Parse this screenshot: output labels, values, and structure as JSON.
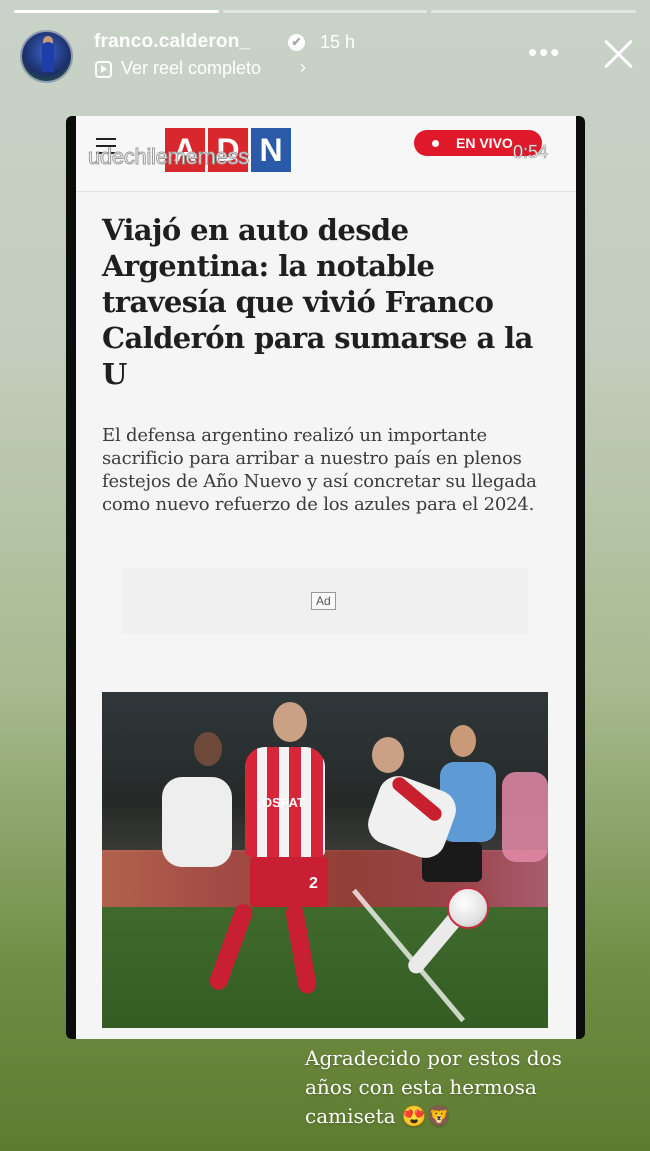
{
  "story": {
    "progress_segments": [
      {
        "state": "done"
      },
      {
        "state": "pending"
      },
      {
        "state": "pending"
      }
    ]
  },
  "header": {
    "username": "franco.calderon_",
    "verified_icon": "verified-badge-icon",
    "time_ago": "15 h",
    "reel_link": "Ver reel completo",
    "reel_chevron": "›",
    "more_icon": "more-options-icon",
    "close_icon": "close-icon"
  },
  "article": {
    "site_logo": [
      "A",
      "D",
      "N"
    ],
    "watermark": "udechilememess",
    "live_label": "EN VIVO",
    "timer": "0:54",
    "headline": "Viajó en auto desde Argentina: la notable travesía que vivió Franco Calderón para sumarse a la U",
    "lead": "El defensa argentino realizó un importante sacrificio para arribar a nuestro país en plenos festejos de Año Nuevo y así concretar su llegada como nuevo refuerzo de los azules para el 2024.",
    "ad_label": "Ad",
    "jersey_sponsor": "OSPAT",
    "jersey_number": "2"
  },
  "caption": {
    "text": "Agradecido por estos dos años con esta hermosa camiseta 😍🦁"
  },
  "colors": {
    "adn_red": "#d9272e",
    "adn_blue": "#2a5aa8",
    "live_red": "#e0192a",
    "background_green": "#6f8c42"
  }
}
